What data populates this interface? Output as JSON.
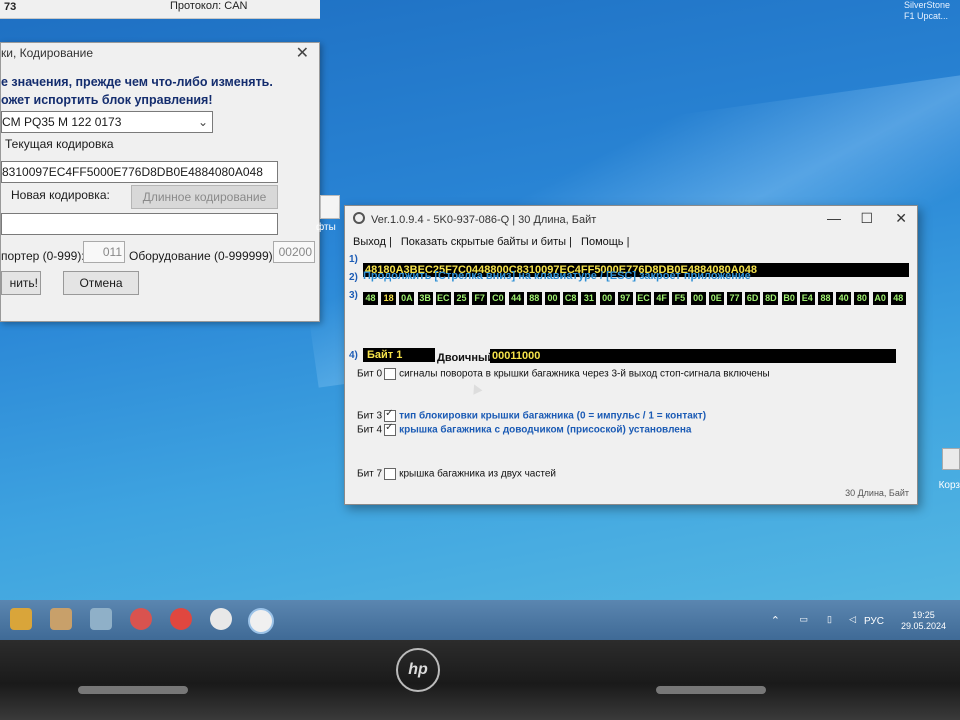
{
  "desktop": {
    "top_right_text": [
      "SilverStone",
      "F1 Upcat..."
    ],
    "file_label": "фты",
    "bin_label": "Корз"
  },
  "coding_dialog": {
    "top_num": "73",
    "protocol": "Протокол: CAN",
    "title": "ки, Кодирование",
    "warning_line1": "е значения, прежде чем что-либо изменять.",
    "warning_line2": "ожет испортить блок управления!",
    "ecu_value": "CM PQ35 M    122 0173",
    "current_label": "Текущая кодировка",
    "current_code": "8310097EC4FF5000E776D8DB0E4884080A048",
    "new_label": "Новая кодировка:",
    "long_coding_button": "Длинное кодирование",
    "importer_label": "портер (0-999):",
    "importer_value": "011",
    "equipment_label": "Оборудование (0-999999):",
    "equipment_value": "00200",
    "apply_button": "нить!",
    "cancel_button": "Отмена"
  },
  "app_window": {
    "title": "Ver.1.0.9.4 -    5K0-937-086-Q | 30 Длина, Байт",
    "menu": [
      "Выход |",
      "Показать скрытые байты и биты |",
      "Помощь |"
    ],
    "row_numbers": [
      "1)",
      "2)",
      "3)",
      "4)"
    ],
    "long_code": "48180A3BEC25F7C0448800C8310097EC4FF5000E776D8DB0E4884080A048",
    "continue_text": "Продолжить [Стрелка вниз] на клавиатуре / [ESC] закроет приложение",
    "bytes": [
      "48",
      "18",
      "0A",
      "3B",
      "EC",
      "25",
      "F7",
      "C0",
      "44",
      "88",
      "00",
      "C8",
      "31",
      "00",
      "97",
      "EC",
      "4F",
      "F5",
      "00",
      "0E",
      "77",
      "6D",
      "8D",
      "B0",
      "E4",
      "88",
      "40",
      "80",
      "A0",
      "48"
    ],
    "selected_byte_index": 1,
    "byte_title": "Байт 1",
    "binary_label": "Двоичный:",
    "binary_value": "00011000",
    "bits": [
      {
        "label": "Бит 0",
        "text": "сигналы поворота в крышки багажника через 3-й выход стоп-сигнала включены",
        "checked": false
      },
      {
        "label": "Бит 3",
        "text": "тип блокировки крышки багажника (0 = импульс / 1 = контакт)",
        "checked": true
      },
      {
        "label": "Бит 4",
        "text": "крышка багажника с доводчиком (присоской) установлена",
        "checked": true
      },
      {
        "label": "Бит 7",
        "text": "крышка багажника из двух частей",
        "checked": false
      }
    ],
    "status": "30 Длина, Байт"
  },
  "taskbar": {
    "language": "РУС",
    "time": "19:25",
    "date": "29.05.2024"
  },
  "bezel": {
    "logo": "hp"
  }
}
